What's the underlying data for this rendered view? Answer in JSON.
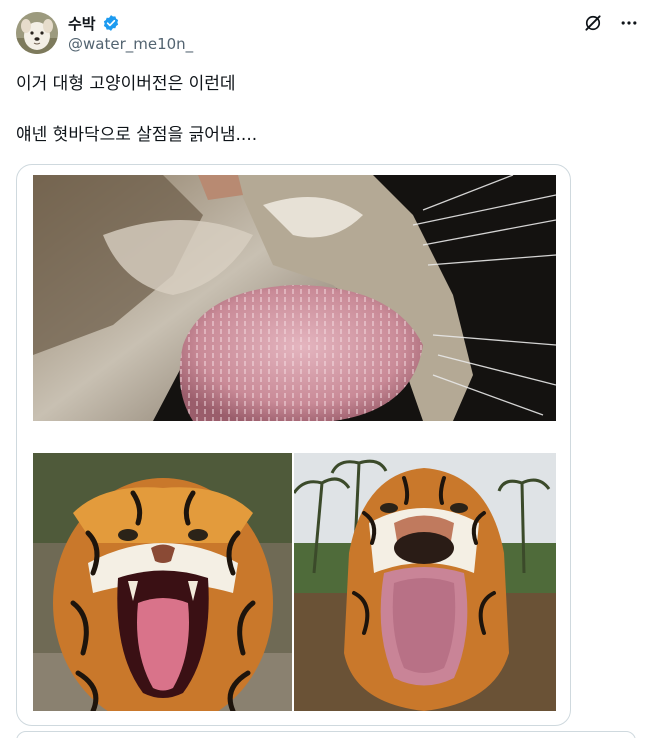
{
  "author": {
    "display_name": "수박",
    "handle": "@water_me10n_",
    "verified": true,
    "avatar_icon": "dog-avatar"
  },
  "actions": {
    "grok_icon": "grok-icon",
    "more_icon": "more-dots-icon"
  },
  "tweet": {
    "lines": [
      "이거 대형 고양이버전은 이런데",
      "얘넨 혓바닥으로 살점을 긁어냄...."
    ]
  },
  "media": {
    "photos": [
      {
        "subject": "cat-tongue-closeup"
      },
      {
        "subject": "tiger-yawning"
      },
      {
        "subject": "tiger-tongue-out"
      }
    ]
  },
  "colors": {
    "text": "#0f1419",
    "secondary": "#536471",
    "verified_blue": "#1d9bf0",
    "border": "#cfd9de"
  }
}
